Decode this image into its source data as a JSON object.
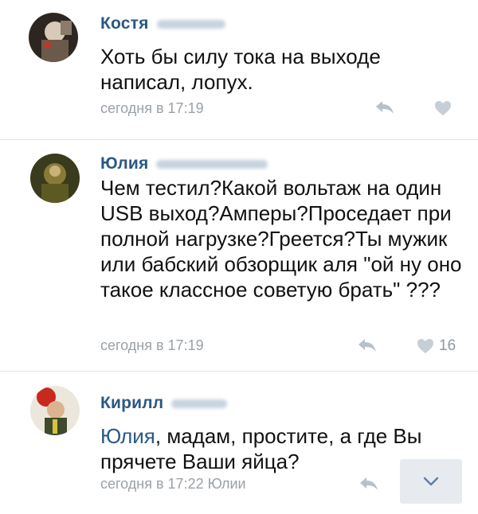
{
  "comments": [
    {
      "author": "Костя",
      "text": "Хоть бы силу тока на выходе написал, лопух.",
      "time": "сегодня в 17:19",
      "likes": ""
    },
    {
      "author": "Юлия",
      "text": "Чем тестил?Какой вольтаж на один USB выход?Амперы?Проседает при полной нагрузке?Греется?Ты мужик или бабский обзорщик аля \"ой ну оно такое классное советую брать\" ???",
      "time": "сегодня в 17:19",
      "likes": "16"
    },
    {
      "author": "Кирилл",
      "mention": "Юлия",
      "text": ", мадам, простите, а где Вы прячете Ваши яйца?",
      "time": "сегодня в 17:22 Юлии",
      "likes": ""
    }
  ],
  "icons": {
    "reply": "reply-arrow-icon",
    "like": "heart-icon",
    "expand": "chevron-down-icon"
  },
  "colors": {
    "author": "#2a5885",
    "meta": "#9aa1a8",
    "icon": "#b8c1cb",
    "divider": "#dfe3e8"
  }
}
